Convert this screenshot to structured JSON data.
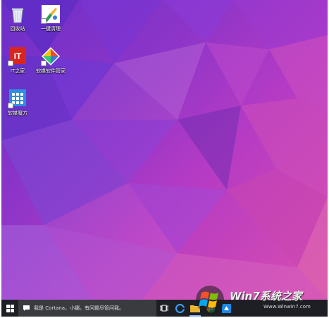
{
  "desktop": {
    "icons": [
      {
        "label": "回收站",
        "icon": "recycle-bin-icon"
      },
      {
        "label": "一键清理",
        "icon": "broom-cleanup-icon"
      },
      {
        "label": "IT之家",
        "icon": "ithome-logo-icon",
        "badge": "IT"
      },
      {
        "label": "软媒软件管家",
        "icon": "software-manager-icon"
      },
      {
        "label": "软媒魔方",
        "icon": "ruanmei-cube-icon"
      }
    ]
  },
  "taskbar": {
    "search_placeholder": "我是 Cortana，小娜。有问题尽管问我。",
    "buttons": [
      "start-icon",
      "task-view-icon",
      "edge-icon",
      "file-explorer-icon",
      "chrome-icon",
      "store-icon",
      "app-icon"
    ]
  },
  "watermark": {
    "text": "Win7系统之家",
    "url": "Www.Winwin7.com"
  },
  "colors": {
    "taskbar": "#1d1f24",
    "search_box": "#3a3b3f",
    "wallpaper_purple": "#6a2fc9",
    "wallpaper_pink": "#d94fae"
  }
}
